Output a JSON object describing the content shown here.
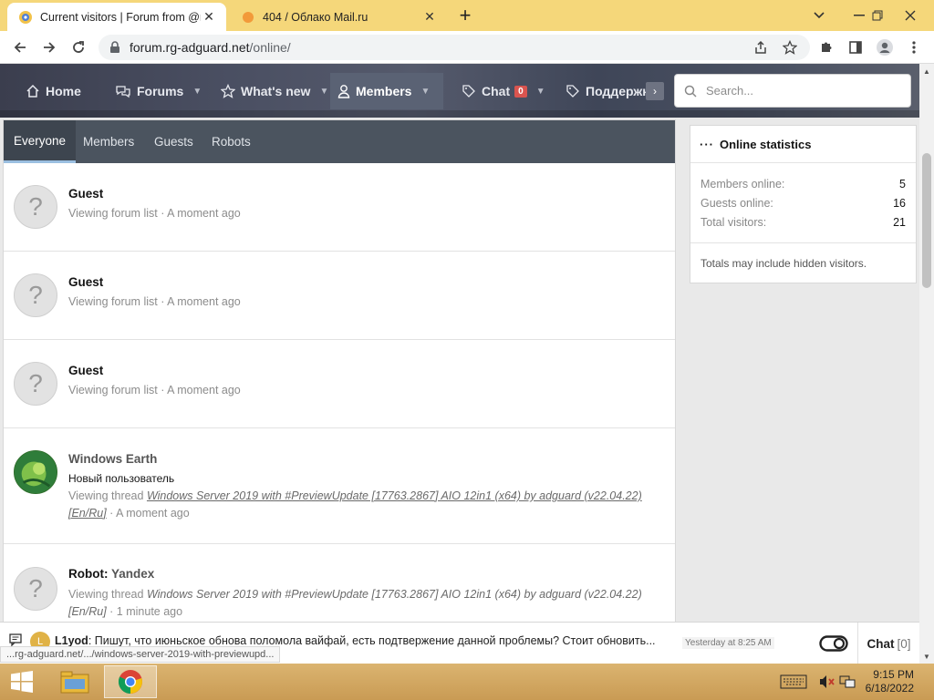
{
  "browser": {
    "tabs": [
      {
        "title": "Current visitors | Forum from @rg",
        "active": true
      },
      {
        "title": "404 / Облако Mail.ru",
        "active": false
      }
    ],
    "url_host": "forum.rg-adguard.net",
    "url_path": "/online/"
  },
  "nav": {
    "items": [
      {
        "label": "Home"
      },
      {
        "label": "Forums"
      },
      {
        "label": "What's new"
      },
      {
        "label": "Members"
      },
      {
        "label": "Chat",
        "badge": "0"
      },
      {
        "label": "Поддержка"
      }
    ],
    "search_placeholder": "Search..."
  },
  "filter_tabs": [
    "Everyone",
    "Members",
    "Guests",
    "Robots"
  ],
  "visitors": [
    {
      "name": "Guest",
      "info": "Viewing forum list · A moment ago"
    },
    {
      "name": "Guest",
      "info": "Viewing forum list · A moment ago"
    },
    {
      "name": "Guest",
      "info": "Viewing forum list · A moment ago"
    },
    {
      "name": "Windows Earth",
      "title": "Новый пользователь",
      "info_prefix": "Viewing thread ",
      "thread": "Windows Server 2019 with #PreviewUpdate [17763.2867] AIO 12in1 (x64) by adguard (v22.04.22) [En/Ru]",
      "info_suffix": " · A moment ago"
    },
    {
      "name_prefix": "Robot: ",
      "name": "Yandex",
      "info_prefix": "Viewing thread ",
      "thread": "Windows Server 2019 with #PreviewUpdate [17763.2867] AIO 12in1 (x64) by adguard (v22.04.22) [En/Ru]",
      "info_suffix": " · 1 minute ago"
    }
  ],
  "sidebar": {
    "title": "Online statistics",
    "stats": [
      {
        "label": "Members online:",
        "value": "5"
      },
      {
        "label": "Guests online:",
        "value": "16"
      },
      {
        "label": "Total visitors:",
        "value": "21"
      }
    ],
    "note": "Totals may include hidden visitors."
  },
  "chat": {
    "avatar_letter": "L",
    "author": "L1yod",
    "message": "Пишут, что июньское обнова поломола вайфай, есть подтвержение данной проблемы? Стоит обновить...",
    "time": "Yesterday at 8:25 AM",
    "label": "Chat",
    "count": "[0]"
  },
  "status_url": "...rg-adguard.net/.../windows-server-2019-with-previewupd...",
  "taskbar": {
    "time": "9:15 PM",
    "date": "6/18/2022"
  },
  "colors": {
    "tabstrip": "#f5d77a",
    "forum_tabs": "#4b545f",
    "badge": "#d9544f"
  }
}
